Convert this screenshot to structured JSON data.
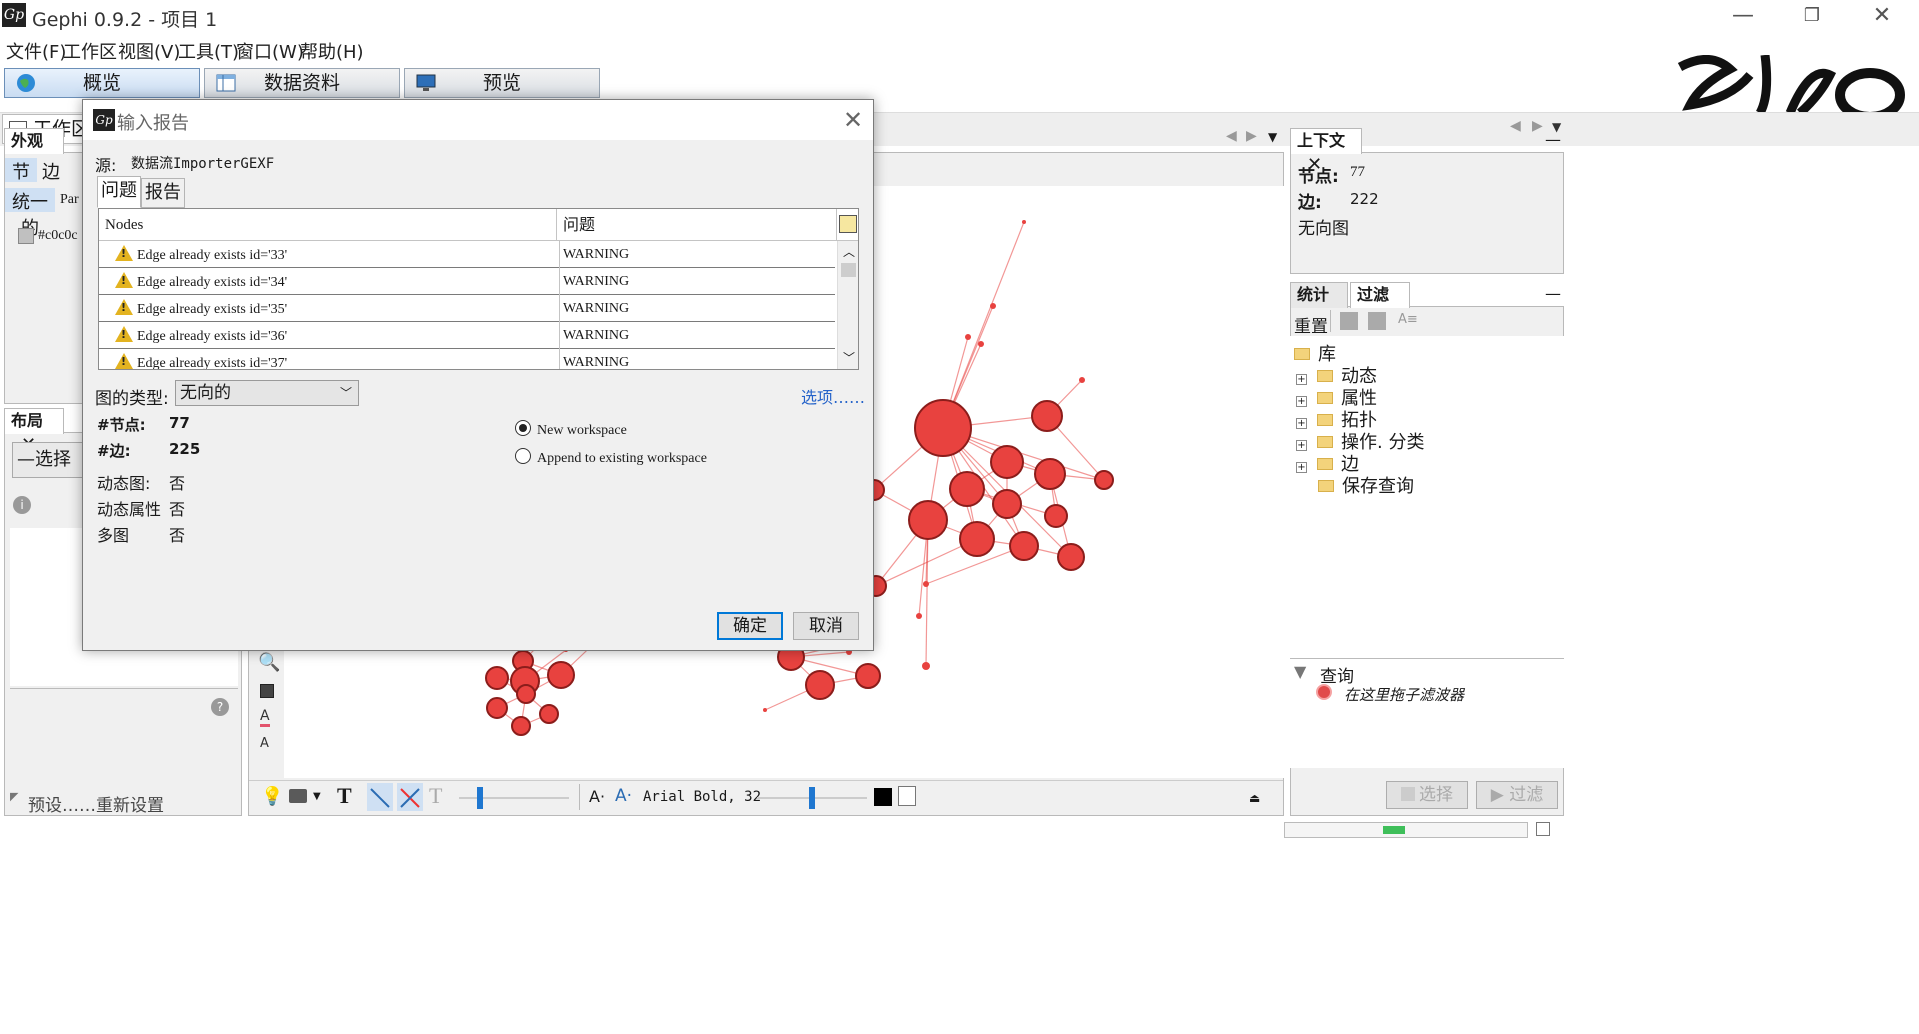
{
  "window": {
    "title": "Gephi 0.9.2 - 项目 1",
    "icon_label": "Gp",
    "minimize": "—",
    "restore": "❐",
    "close": "✕"
  },
  "menu": [
    "文件(F)",
    "工作区",
    "视图(V)",
    "工具(T)",
    "窗口(W)",
    "帮助(H)"
  ],
  "perspectives": [
    {
      "label": "概览",
      "active": true,
      "icon": "globe-icon"
    },
    {
      "label": "数据资料",
      "active": false,
      "icon": "table-icon"
    },
    {
      "label": "预览",
      "active": false,
      "icon": "monitor-icon"
    }
  ],
  "workspace_tab": "工作区",
  "appearance": {
    "tab": "外观",
    "subtabs": [
      "节点",
      "边"
    ],
    "mode": "统一的",
    "mode2": "Par",
    "color": "#c0c0c",
    "swatch": "#c0c0c0"
  },
  "layout_panel": {
    "tab": "布局",
    "select": "—选择",
    "presets": "预设……",
    "reset": "重新设置"
  },
  "context": {
    "tab": "上下文",
    "nodes_label": "节点:",
    "nodes_value": "77",
    "edges_label": "边:",
    "edges_value": "222",
    "graph_type": "无向图"
  },
  "filters": {
    "tab_stats": "统计",
    "tab_filter": "过滤",
    "reset": "重置",
    "library": "库",
    "items": [
      "动态",
      "属性",
      "拓扑",
      "操作. 分类",
      "边",
      "保存查询"
    ],
    "query_title": "查询",
    "query_hint": "在这里拖子滤波器",
    "select_btn": "选择",
    "filter_btn": "过滤"
  },
  "bottom_toolbar": {
    "font": "Arial Bold, 32",
    "font_a1": "A·",
    "font_a2": "A·"
  },
  "dialog": {
    "title": "输入报告",
    "icon_label": "Gp",
    "source_label": "源:",
    "source_value": "数据流ImporterGEXF",
    "tabs": [
      "问题",
      "报告"
    ],
    "columns": [
      "Nodes",
      "问题"
    ],
    "rows": [
      {
        "message": "Edge already exists id='33'",
        "level": "WARNING"
      },
      {
        "message": "Edge already exists id='34'",
        "level": "WARNING"
      },
      {
        "message": "Edge already exists id='35'",
        "level": "WARNING"
      },
      {
        "message": "Edge already exists id='36'",
        "level": "WARNING"
      },
      {
        "message": "Edge already exists id='37'",
        "level": "WARNING"
      }
    ],
    "graph_type_label": "图的类型:",
    "graph_type_value": "无向的",
    "options_link": "选项……",
    "nodes_label": "#节点:",
    "nodes_value": "77",
    "edges_label": "#边:",
    "edges_value": "225",
    "dynamic_label": "动态图:",
    "dynamic_value": "否",
    "dynattr_label": "动态属性",
    "dynattr_value": "否",
    "multi_label": "多图",
    "multi_value": "否",
    "radio_new": "New workspace",
    "radio_append": "Append to existing workspace",
    "ok": "确定",
    "cancel": "取消"
  },
  "colors": {
    "node_fill": "#e8423f",
    "node_stroke": "#8b1d1b",
    "edge": "#e8423f"
  }
}
